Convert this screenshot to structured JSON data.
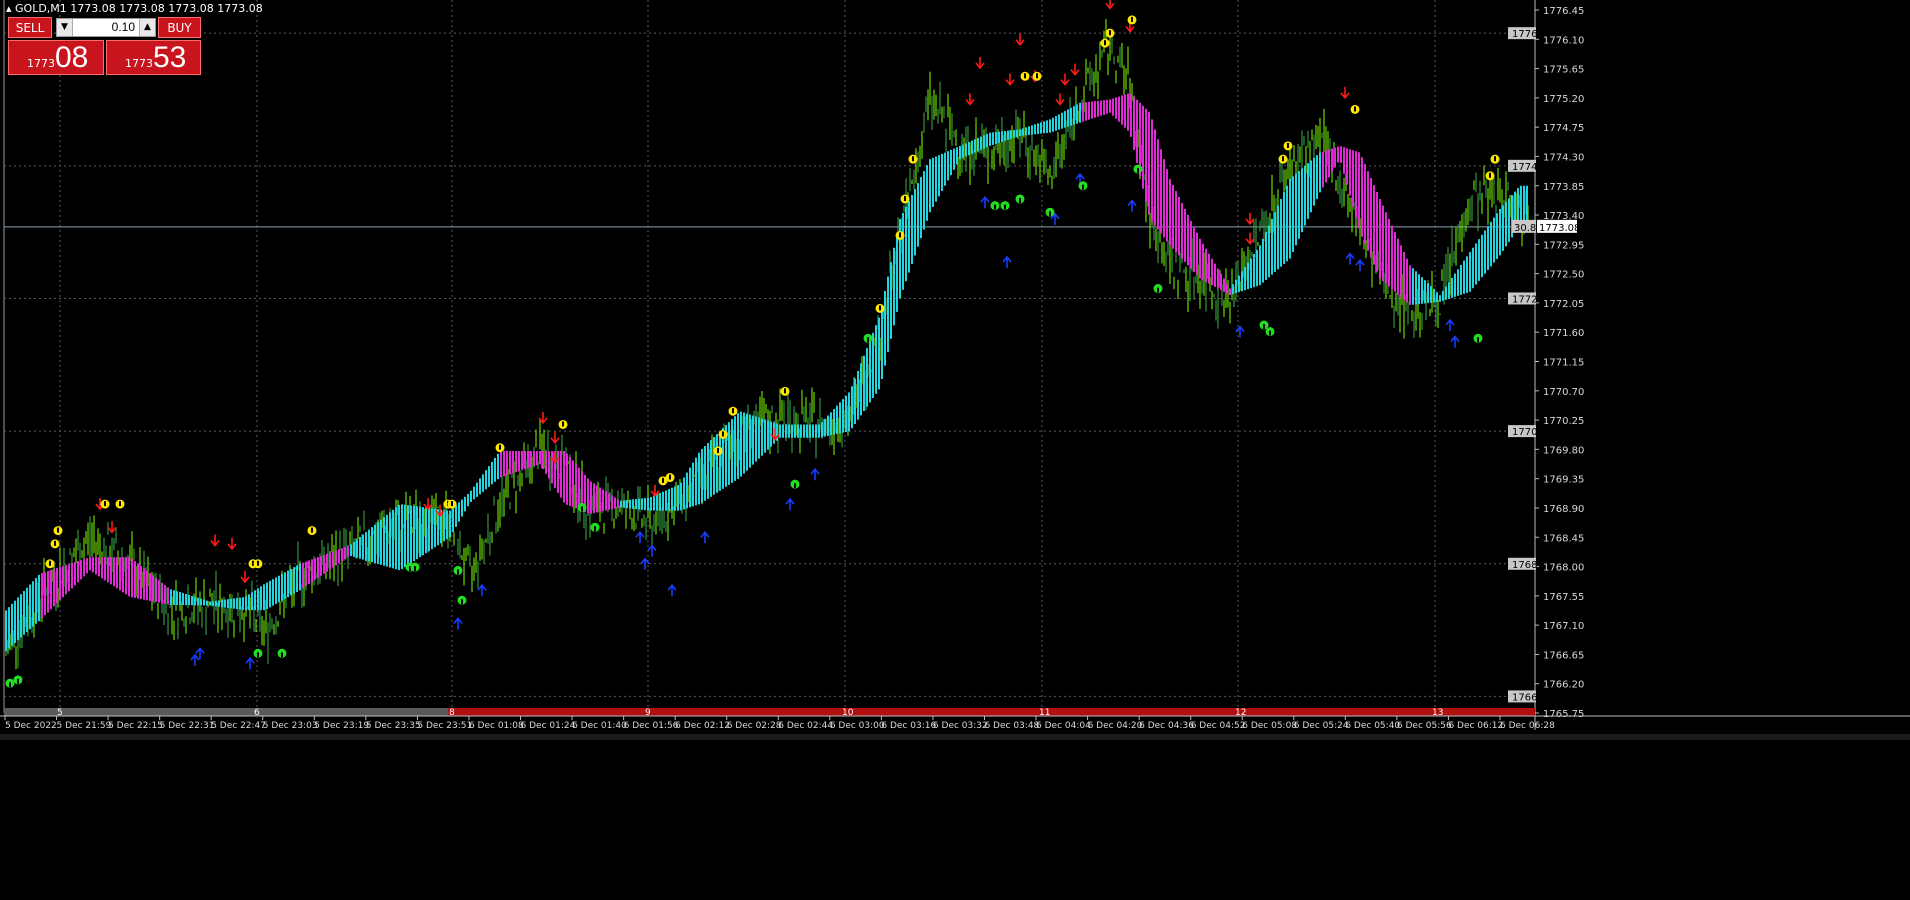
{
  "window": {
    "symbol_line": "GOLD,M1  1773.08 1773.08 1773.08 1773.08"
  },
  "trade_panel": {
    "sell_label": "SELL",
    "buy_label": "BUY",
    "volume": "0.10",
    "sell_price_small": "1773",
    "sell_price_big": "08",
    "buy_price_small": "1773",
    "buy_price_big": "53"
  },
  "colors": {
    "background": "#000000",
    "candle_up": "#7fff00",
    "candle_down": "#3cb04a",
    "ribbon_up": "#22d6e0",
    "ribbon_down": "#e02ad6",
    "arrow_down": "#ff1a1a",
    "arrow_up": "#1a3cff",
    "marker_yellow": "#ffe600",
    "marker_green": "#22dd22",
    "bid_line": "#8aa0b4",
    "sep_bar": "#b01010"
  },
  "chart_data": {
    "type": "line",
    "symbol": "GOLD",
    "timeframe": "M1",
    "ylim": [
      1765.75,
      1776.5
    ],
    "grid": true,
    "price_axis_labels": [
      "1776.45",
      "1776.10",
      "1775.65",
      "1775.20",
      "1774.75",
      "1774.30",
      "1773.85",
      "1773.40",
      "1772.95",
      "1772.50",
      "1772.05",
      "1771.60",
      "1771.15",
      "1770.70",
      "1770.25",
      "1769.80",
      "1769.35",
      "1768.90",
      "1768.45",
      "1768.00",
      "1767.55",
      "1767.10",
      "1766.65",
      "1766.20",
      "1765.75"
    ],
    "level_tags": [
      {
        "label": "1776",
        "value": 1776.0
      },
      {
        "label": "1774",
        "value": 1774.0
      },
      {
        "label": "1772",
        "value": 1772.0
      },
      {
        "label": "1770",
        "value": 1770.0
      },
      {
        "label": "1768",
        "value": 1768.0
      },
      {
        "label": "1766",
        "value": 1766.0
      }
    ],
    "bid_price": {
      "label": "1773.08",
      "value": 1773.08
    },
    "spread_label": "30.8",
    "time_labels": [
      "5 Dec 2022",
      "5 Dec 21:59",
      "5 Dec 22:15",
      "5 Dec 22:31",
      "5 Dec 22:47",
      "5 Dec 23:03",
      "5 Dec 23:19",
      "5 Dec 23:35",
      "5 Dec 23:51",
      "6 Dec 01:08",
      "6 Dec 01:24",
      "6 Dec 01:40",
      "6 Dec 01:56",
      "6 Dec 02:12",
      "6 Dec 02:28",
      "6 Dec 02:44",
      "6 Dec 03:00",
      "6 Dec 03:16",
      "6 Dec 03:32",
      "6 Dec 03:48",
      "6 Dec 04:04",
      "6 Dec 04:20",
      "6 Dec 04:36",
      "6 Dec 04:52",
      "6 Dec 05:08",
      "6 Dec 05:24",
      "6 Dec 05:40",
      "6 Dec 05:56",
      "6 Dec 06:12",
      "6 Dec 06:28"
    ],
    "separator_labels": [
      "5",
      "6",
      "8",
      "9",
      "10",
      "11",
      "12",
      "13"
    ],
    "price_path_x": [
      0,
      40,
      90,
      130,
      170,
      210,
      245,
      265,
      300,
      350,
      400,
      450,
      470,
      500,
      540,
      565,
      590,
      620,
      650,
      680,
      700,
      740,
      780,
      820,
      850,
      880,
      900,
      930,
      960,
      990,
      1020,
      1050,
      1080,
      1110,
      1130,
      1150,
      1170,
      1200,
      1230,
      1260,
      1290,
      1320,
      1340,
      1360,
      1380,
      1410,
      1440,
      1470,
      1500,
      1520
    ],
    "price_path_y": [
      1766.5,
      1767.5,
      1768.4,
      1768.0,
      1767.3,
      1767.4,
      1767.3,
      1767.0,
      1767.8,
      1768.2,
      1768.6,
      1768.7,
      1767.8,
      1768.9,
      1769.7,
      1769.5,
      1768.8,
      1768.9,
      1768.6,
      1768.9,
      1769.2,
      1770.0,
      1770.2,
      1770.1,
      1770.2,
      1771.5,
      1772.9,
      1775.0,
      1774.3,
      1774.2,
      1774.5,
      1773.8,
      1775.0,
      1775.8,
      1775.2,
      1773.2,
      1772.5,
      1772.3,
      1772.0,
      1773.0,
      1774.0,
      1774.4,
      1773.8,
      1773.0,
      1772.3,
      1771.8,
      1772.0,
      1773.5,
      1773.6,
      1773.3
    ],
    "ribbon_center": [
      1766.9,
      1767.5,
      1768.0,
      1767.8,
      1767.5,
      1767.4,
      1767.4,
      1767.5,
      1767.8,
      1768.2,
      1768.4,
      1768.6,
      1769.0,
      1769.5,
      1769.6,
      1769.3,
      1769.0,
      1768.9,
      1768.9,
      1769.0,
      1769.3,
      1769.8,
      1770.0,
      1770.0,
      1770.3,
      1771.2,
      1772.6,
      1773.7,
      1774.2,
      1774.4,
      1774.5,
      1774.6,
      1774.8,
      1774.9,
      1774.8,
      1774.0,
      1773.3,
      1772.6,
      1772.1,
      1772.5,
      1773.2,
      1773.9,
      1774.2,
      1773.6,
      1772.9,
      1772.2,
      1772.0,
      1772.4,
      1773.0,
      1773.4
    ],
    "ribbon_halfwidth": [
      0.3,
      0.35,
      0.1,
      0.3,
      0.12,
      0.03,
      0.1,
      0.2,
      0.2,
      0.08,
      0.5,
      0.2,
      0.08,
      0.2,
      0.1,
      0.4,
      0.25,
      0.05,
      0.1,
      0.2,
      0.4,
      0.5,
      0.1,
      0.1,
      0.3,
      0.55,
      0.6,
      0.4,
      0.1,
      0.1,
      0.05,
      0.1,
      0.15,
      0.1,
      0.3,
      0.8,
      0.5,
      0.3,
      0.05,
      0.3,
      0.6,
      0.3,
      0.1,
      0.6,
      0.6,
      0.3,
      0.05,
      0.3,
      0.35,
      0.3
    ],
    "ribbon_dir": [
      "up",
      "up",
      "down",
      "down",
      "down",
      "up",
      "up",
      "up",
      "up",
      "down",
      "up",
      "up",
      "up",
      "up",
      "down",
      "down",
      "down",
      "down",
      "up",
      "up",
      "up",
      "up",
      "up",
      "up",
      "up",
      "up",
      "up",
      "up",
      "up",
      "up",
      "up",
      "up",
      "up",
      "down",
      "down",
      "down",
      "down",
      "down",
      "down",
      "up",
      "up",
      "up",
      "down",
      "down",
      "down",
      "down",
      "up",
      "up",
      "up",
      "up"
    ],
    "down_arrows": [
      [
        100,
        1768.9
      ],
      [
        215,
        1768.35
      ],
      [
        232,
        1768.3
      ],
      [
        245,
        1767.8
      ],
      [
        428,
        1768.9
      ],
      [
        440,
        1768.8
      ],
      [
        543,
        1770.2
      ],
      [
        555,
        1769.6
      ],
      [
        655,
        1769.1
      ],
      [
        775,
        1769.95
      ],
      [
        980,
        1775.55
      ],
      [
        970,
        1775.0
      ],
      [
        1020,
        1775.9
      ],
      [
        1010,
        1775.3
      ],
      [
        1035,
        1775.35
      ],
      [
        1065,
        1775.3
      ],
      [
        1060,
        1775.0
      ],
      [
        1075,
        1775.45
      ],
      [
        1110,
        1776.45
      ],
      [
        1130,
        1776.1
      ],
      [
        1250,
        1773.2
      ],
      [
        1250,
        1772.9
      ],
      [
        1345,
        1775.1
      ],
      [
        555,
        1769.9
      ],
      [
        112,
        1768.55
      ]
    ],
    "up_arrows": [
      [
        200,
        1766.65
      ],
      [
        195,
        1766.55
      ],
      [
        250,
        1766.5
      ],
      [
        458,
        1767.1
      ],
      [
        482,
        1767.6
      ],
      [
        640,
        1768.4
      ],
      [
        645,
        1768.0
      ],
      [
        652,
        1768.2
      ],
      [
        672,
        1767.6
      ],
      [
        705,
        1768.4
      ],
      [
        790,
        1768.9
      ],
      [
        815,
        1769.35
      ],
      [
        985,
        1773.45
      ],
      [
        1007,
        1772.55
      ],
      [
        1055,
        1773.2
      ],
      [
        1080,
        1773.8
      ],
      [
        1132,
        1773.4
      ],
      [
        1240,
        1771.5
      ],
      [
        1350,
        1772.6
      ],
      [
        1360,
        1772.5
      ],
      [
        1450,
        1771.6
      ],
      [
        1455,
        1771.35
      ]
    ],
    "yellow_markers": [
      [
        50,
        1768.0
      ],
      [
        55,
        1768.3
      ],
      [
        58,
        1768.5
      ],
      [
        105,
        1768.9
      ],
      [
        120,
        1768.9
      ],
      [
        253,
        1768.0
      ],
      [
        258,
        1768.0
      ],
      [
        312,
        1768.5
      ],
      [
        448,
        1768.9
      ],
      [
        452,
        1768.9
      ],
      [
        500,
        1769.75
      ],
      [
        563,
        1770.1
      ],
      [
        663,
        1769.25
      ],
      [
        670,
        1769.3
      ],
      [
        718,
        1769.7
      ],
      [
        723,
        1769.95
      ],
      [
        733,
        1770.3
      ],
      [
        785,
        1770.6
      ],
      [
        900,
        1772.95
      ],
      [
        905,
        1773.5
      ],
      [
        913,
        1774.1
      ],
      [
        880,
        1771.85
      ],
      [
        1025,
        1775.35
      ],
      [
        1037,
        1775.35
      ],
      [
        1105,
        1775.85
      ],
      [
        1110,
        1776.0
      ],
      [
        1132,
        1776.2
      ],
      [
        1283,
        1774.1
      ],
      [
        1288,
        1774.3
      ],
      [
        1355,
        1774.85
      ],
      [
        1490,
        1773.85
      ],
      [
        1495,
        1774.1
      ]
    ],
    "green_markers": [
      [
        10,
        1766.2
      ],
      [
        18,
        1766.25
      ],
      [
        258,
        1766.65
      ],
      [
        282,
        1766.65
      ],
      [
        410,
        1767.95
      ],
      [
        415,
        1767.95
      ],
      [
        458,
        1767.9
      ],
      [
        462,
        1767.45
      ],
      [
        582,
        1768.85
      ],
      [
        595,
        1768.55
      ],
      [
        795,
        1769.2
      ],
      [
        995,
        1773.4
      ],
      [
        1005,
        1773.4
      ],
      [
        1020,
        1773.5
      ],
      [
        1050,
        1773.3
      ],
      [
        1083,
        1773.7
      ],
      [
        1138,
        1773.95
      ],
      [
        1158,
        1772.15
      ],
      [
        1264,
        1771.6
      ],
      [
        1270,
        1771.5
      ],
      [
        1478,
        1771.4
      ],
      [
        868,
        1771.4
      ]
    ]
  }
}
